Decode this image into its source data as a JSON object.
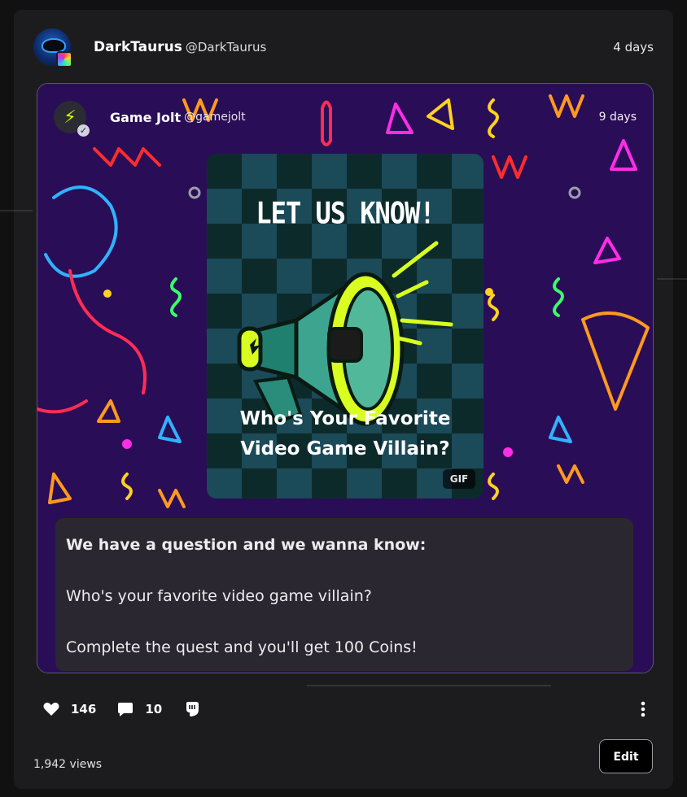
{
  "post": {
    "author_name": "DarkTaurus",
    "author_handle": "@DarkTaurus",
    "time": "4 days",
    "likes": "146",
    "comments": "10",
    "views": "1,942 views",
    "edit_label": "Edit"
  },
  "repost": {
    "author_name": "Game Jolt",
    "author_handle": "@gamejolt",
    "time": "9 days",
    "gif": {
      "title": "LET US KNOW!",
      "caption_line1": "Who's Your Favorite",
      "caption_line2": "Video Game Villain?",
      "tag": "GIF"
    },
    "text_line1": "We have a question and we wanna know:",
    "text_line2": "Who's your favorite video game villain?",
    "text_line3": "Complete the quest and you'll get 100 Coins!"
  },
  "colors": {
    "card_bg": "#1c1c1f",
    "repost_bg": "#2a0d57",
    "accent_lime": "#ccff00"
  }
}
